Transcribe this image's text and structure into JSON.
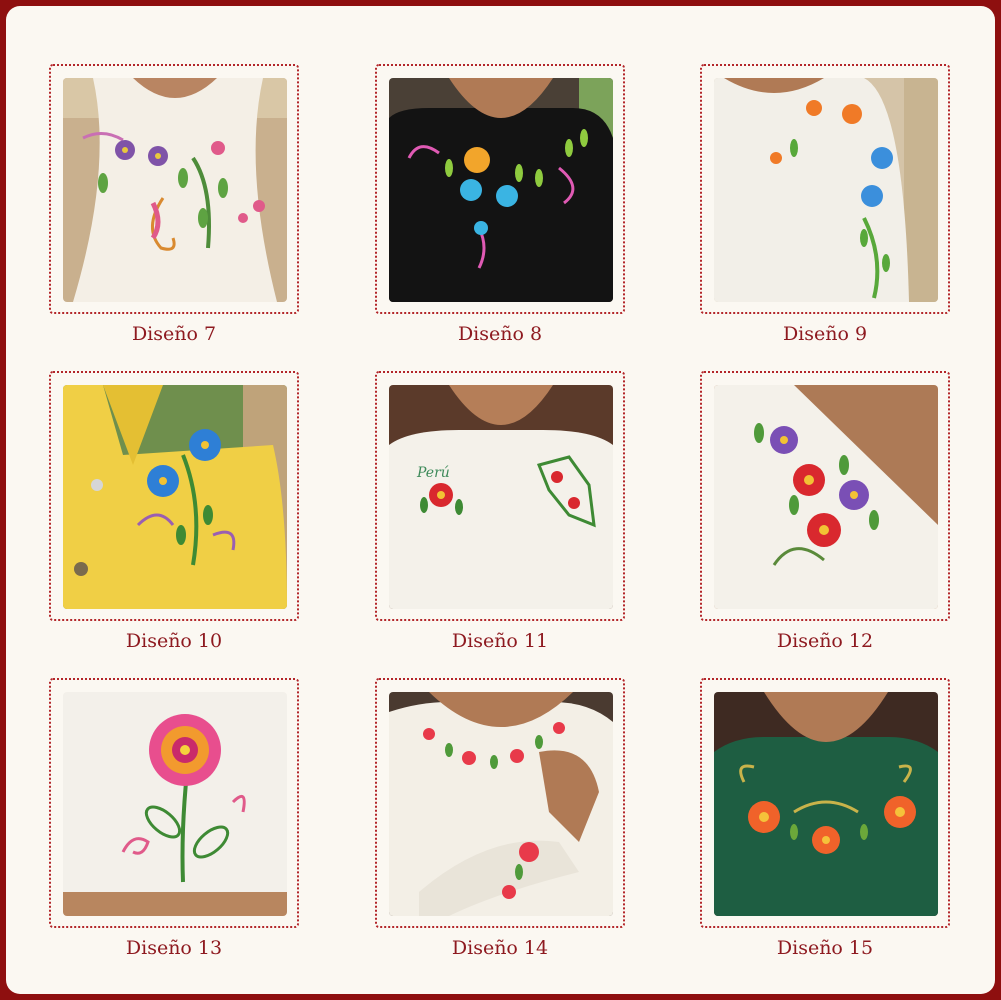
{
  "colors": {
    "border": "#8e0f0f",
    "background": "#fbf8f2",
    "accent": "#b3262a",
    "caption": "#8e1a20"
  },
  "designs": [
    {
      "caption": "Diseño 7"
    },
    {
      "caption": "Diseño 8"
    },
    {
      "caption": "Diseño 9"
    },
    {
      "caption": "Diseño 10"
    },
    {
      "caption": "Diseño 11"
    },
    {
      "caption": "Diseño 12"
    },
    {
      "caption": "Diseño 13"
    },
    {
      "caption": "Diseño 14"
    },
    {
      "caption": "Diseño 15"
    }
  ],
  "embroidery_text": "Perú"
}
